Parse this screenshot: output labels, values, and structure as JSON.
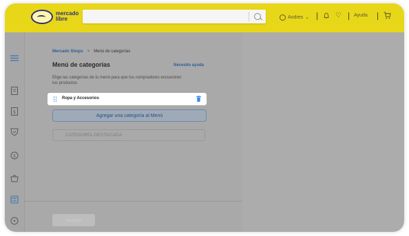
{
  "header": {
    "logo_line1": "mercado",
    "logo_line2": "libre",
    "search_placeholder": "",
    "user_name": "Andres",
    "help_label": "Ayuda"
  },
  "sidebar": {
    "icons": [
      "menu-icon",
      "document-icon",
      "dollar-icon",
      "badge-icon",
      "money-icon",
      "bag-icon",
      "shop-icon",
      "more-icon"
    ]
  },
  "content": {
    "breadcrumb": {
      "parent": "Mercado Shops",
      "separator": ">",
      "current": "Menú de categorías"
    },
    "title": "Menú de categorías",
    "help_link": "Necesito ayuda",
    "description": "Elige las categorías de tu menú para que tus compradores encuentren tus productos",
    "category_item": "Ropa y Accesorios",
    "add_button": "Agregar una categoría al Menú",
    "featured_label": "CATEGORÍA DESTACADA",
    "save_button": "Guardar"
  },
  "colors": {
    "brand_yellow": "#e8d619",
    "link_blue": "#2b5d9a",
    "overlay_gray": "#a9a9a9",
    "trash_blue": "#3a8ee6"
  }
}
